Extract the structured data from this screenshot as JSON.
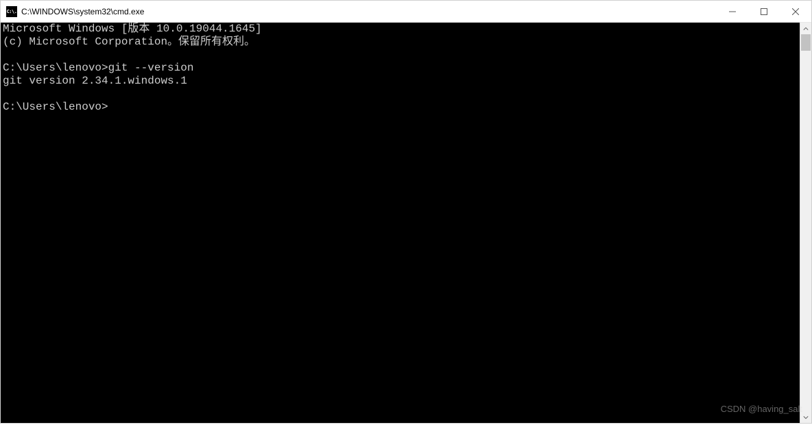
{
  "window": {
    "icon_text": "C:\\.",
    "title": "C:\\WINDOWS\\system32\\cmd.exe"
  },
  "terminal": {
    "lines": [
      "Microsoft Windows [版本 10.0.19044.1645]",
      "(c) Microsoft Corporation。保留所有权利。",
      "",
      "C:\\Users\\lenovo>git --version",
      "git version 2.34.1.windows.1",
      "",
      "C:\\Users\\lenovo>"
    ]
  },
  "watermark": "CSDN @having_salt"
}
